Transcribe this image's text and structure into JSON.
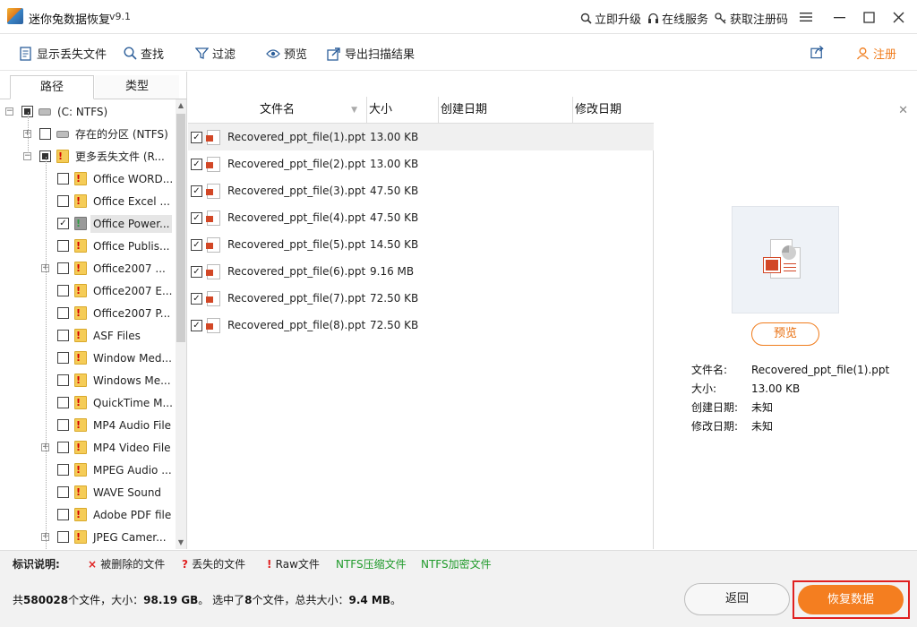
{
  "titlebar": {
    "app_title": "迷你兔数据恢复",
    "version": "v9.1",
    "links": [
      "立即升级",
      "在线服务",
      "获取注册码"
    ]
  },
  "toolbar": {
    "show_lost": "显示丢失文件",
    "find": "查找",
    "filter": "过滤",
    "preview": "预览",
    "export": "导出扫描结果",
    "register": "注册"
  },
  "left": {
    "tabs": [
      "路径",
      "类型"
    ],
    "tree": [
      {
        "label": "(C: NTFS)",
        "level": 0,
        "check": "partial",
        "icon": "drive",
        "expander": "minus"
      },
      {
        "label": "存在的分区 (NTFS)",
        "level": 1,
        "check": "none",
        "icon": "drive",
        "expander": "plus"
      },
      {
        "label": "更多丢失文件 (R...",
        "level": 1,
        "check": "partial",
        "icon": "folder",
        "expander": "minus"
      },
      {
        "label": "Office WORD...",
        "level": 2,
        "check": "none",
        "icon": "folder",
        "expander": ""
      },
      {
        "label": "Office Excel ...",
        "level": 2,
        "check": "none",
        "icon": "folder",
        "expander": ""
      },
      {
        "label": "Office Power...",
        "level": 2,
        "check": "checked",
        "icon": "folder-gray",
        "expander": "",
        "selected": true
      },
      {
        "label": "Office Publis...",
        "level": 2,
        "check": "none",
        "icon": "folder",
        "expander": ""
      },
      {
        "label": "Office2007 ...",
        "level": 2,
        "check": "none",
        "icon": "folder",
        "expander": "plus"
      },
      {
        "label": "Office2007 E...",
        "level": 2,
        "check": "none",
        "icon": "folder",
        "expander": ""
      },
      {
        "label": "Office2007 P...",
        "level": 2,
        "check": "none",
        "icon": "folder",
        "expander": ""
      },
      {
        "label": "ASF Files",
        "level": 2,
        "check": "none",
        "icon": "folder",
        "expander": ""
      },
      {
        "label": "Window Med...",
        "level": 2,
        "check": "none",
        "icon": "folder",
        "expander": ""
      },
      {
        "label": "Windows Me...",
        "level": 2,
        "check": "none",
        "icon": "folder",
        "expander": ""
      },
      {
        "label": "QuickTime M...",
        "level": 2,
        "check": "none",
        "icon": "folder",
        "expander": ""
      },
      {
        "label": "MP4 Audio File",
        "level": 2,
        "check": "none",
        "icon": "folder",
        "expander": ""
      },
      {
        "label": "MP4 Video File",
        "level": 2,
        "check": "none",
        "icon": "folder",
        "expander": "plus"
      },
      {
        "label": "MPEG Audio ...",
        "level": 2,
        "check": "none",
        "icon": "folder",
        "expander": ""
      },
      {
        "label": "WAVE Sound",
        "level": 2,
        "check": "none",
        "icon": "folder",
        "expander": ""
      },
      {
        "label": "Adobe PDF file",
        "level": 2,
        "check": "none",
        "icon": "folder",
        "expander": ""
      },
      {
        "label": "JPEG Camer...",
        "level": 2,
        "check": "none",
        "icon": "folder",
        "expander": "plus"
      }
    ]
  },
  "filelist": {
    "columns": [
      "文件名",
      "大小",
      "创建日期",
      "修改日期"
    ],
    "rows": [
      {
        "name": "Recovered_ppt_file(1).ppt",
        "size": "13.00 KB"
      },
      {
        "name": "Recovered_ppt_file(2).ppt",
        "size": "13.00 KB"
      },
      {
        "name": "Recovered_ppt_file(3).ppt",
        "size": "47.50 KB"
      },
      {
        "name": "Recovered_ppt_file(4).ppt",
        "size": "47.50 KB"
      },
      {
        "name": "Recovered_ppt_file(5).ppt",
        "size": "14.50 KB"
      },
      {
        "name": "Recovered_ppt_file(6).ppt",
        "size": "9.16 MB"
      },
      {
        "name": "Recovered_ppt_file(7).ppt",
        "size": "72.50 KB"
      },
      {
        "name": "Recovered_ppt_file(8).ppt",
        "size": "72.50 KB"
      }
    ]
  },
  "detail": {
    "preview_button": "预览",
    "info": [
      {
        "label": "文件名:",
        "value": "Recovered_ppt_file(1).ppt"
      },
      {
        "label": "大小:",
        "value": "13.00 KB"
      },
      {
        "label": "创建日期:",
        "value": "未知"
      },
      {
        "label": "修改日期:",
        "value": "未知"
      }
    ]
  },
  "legend": {
    "title": "标识说明:",
    "items": [
      {
        "mark": "×",
        "mark_color": "#e02020",
        "label": "被删除的文件",
        "label_color": "#222222"
      },
      {
        "mark": "?",
        "mark_color": "#e02020",
        "label": "丢失的文件",
        "label_color": "#222222"
      },
      {
        "mark": "!",
        "mark_color": "#e02020",
        "label": "Raw文件",
        "label_color": "#222222"
      },
      {
        "mark": "",
        "mark_color": "",
        "label": "NTFS压缩文件",
        "label_color": "#1f9a2a"
      },
      {
        "mark": "",
        "mark_color": "",
        "label": "NTFS加密文件",
        "label_color": "#1f9a2a"
      }
    ]
  },
  "bottom": {
    "summary_prefix": "共",
    "total_files": "580028",
    "summary_mid1": "个文件，大小：",
    "total_size": "98.19 GB",
    "summary_mid2": "。 选中了",
    "selected_count": "8",
    "summary_mid3": "个文件，总共大小：",
    "selected_size": "9.4 MB",
    "summary_suffix": "。",
    "back_button": "返回",
    "recover_button": "恢复数据"
  },
  "colors": {
    "accent": "#f47e20",
    "highlight_border": "#e02020"
  }
}
